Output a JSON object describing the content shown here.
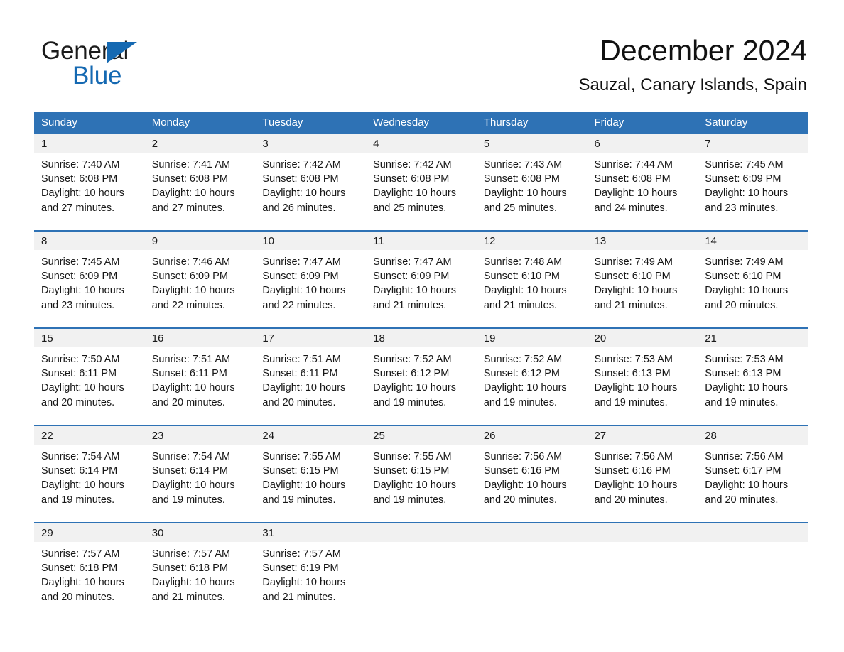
{
  "brand": {
    "name_part1": "General",
    "name_part2": "Blue",
    "triangle_color": "#1569b2"
  },
  "header": {
    "title": "December 2024",
    "subtitle": "Sauzal, Canary Islands, Spain"
  },
  "theme": {
    "header_blue": "#2e72b5",
    "row_border_blue": "#2e72b5",
    "daynum_band": "#f1f1f1",
    "text": "#161616"
  },
  "weekdays": [
    "Sunday",
    "Monday",
    "Tuesday",
    "Wednesday",
    "Thursday",
    "Friday",
    "Saturday"
  ],
  "weeks": [
    [
      {
        "day": "1",
        "sunrise": "Sunrise: 7:40 AM",
        "sunset": "Sunset: 6:08 PM",
        "daylight_line1": "Daylight: 10 hours",
        "daylight_line2": "and 27 minutes."
      },
      {
        "day": "2",
        "sunrise": "Sunrise: 7:41 AM",
        "sunset": "Sunset: 6:08 PM",
        "daylight_line1": "Daylight: 10 hours",
        "daylight_line2": "and 27 minutes."
      },
      {
        "day": "3",
        "sunrise": "Sunrise: 7:42 AM",
        "sunset": "Sunset: 6:08 PM",
        "daylight_line1": "Daylight: 10 hours",
        "daylight_line2": "and 26 minutes."
      },
      {
        "day": "4",
        "sunrise": "Sunrise: 7:42 AM",
        "sunset": "Sunset: 6:08 PM",
        "daylight_line1": "Daylight: 10 hours",
        "daylight_line2": "and 25 minutes."
      },
      {
        "day": "5",
        "sunrise": "Sunrise: 7:43 AM",
        "sunset": "Sunset: 6:08 PM",
        "daylight_line1": "Daylight: 10 hours",
        "daylight_line2": "and 25 minutes."
      },
      {
        "day": "6",
        "sunrise": "Sunrise: 7:44 AM",
        "sunset": "Sunset: 6:08 PM",
        "daylight_line1": "Daylight: 10 hours",
        "daylight_line2": "and 24 minutes."
      },
      {
        "day": "7",
        "sunrise": "Sunrise: 7:45 AM",
        "sunset": "Sunset: 6:09 PM",
        "daylight_line1": "Daylight: 10 hours",
        "daylight_line2": "and 23 minutes."
      }
    ],
    [
      {
        "day": "8",
        "sunrise": "Sunrise: 7:45 AM",
        "sunset": "Sunset: 6:09 PM",
        "daylight_line1": "Daylight: 10 hours",
        "daylight_line2": "and 23 minutes."
      },
      {
        "day": "9",
        "sunrise": "Sunrise: 7:46 AM",
        "sunset": "Sunset: 6:09 PM",
        "daylight_line1": "Daylight: 10 hours",
        "daylight_line2": "and 22 minutes."
      },
      {
        "day": "10",
        "sunrise": "Sunrise: 7:47 AM",
        "sunset": "Sunset: 6:09 PM",
        "daylight_line1": "Daylight: 10 hours",
        "daylight_line2": "and 22 minutes."
      },
      {
        "day": "11",
        "sunrise": "Sunrise: 7:47 AM",
        "sunset": "Sunset: 6:09 PM",
        "daylight_line1": "Daylight: 10 hours",
        "daylight_line2": "and 21 minutes."
      },
      {
        "day": "12",
        "sunrise": "Sunrise: 7:48 AM",
        "sunset": "Sunset: 6:10 PM",
        "daylight_line1": "Daylight: 10 hours",
        "daylight_line2": "and 21 minutes."
      },
      {
        "day": "13",
        "sunrise": "Sunrise: 7:49 AM",
        "sunset": "Sunset: 6:10 PM",
        "daylight_line1": "Daylight: 10 hours",
        "daylight_line2": "and 21 minutes."
      },
      {
        "day": "14",
        "sunrise": "Sunrise: 7:49 AM",
        "sunset": "Sunset: 6:10 PM",
        "daylight_line1": "Daylight: 10 hours",
        "daylight_line2": "and 20 minutes."
      }
    ],
    [
      {
        "day": "15",
        "sunrise": "Sunrise: 7:50 AM",
        "sunset": "Sunset: 6:11 PM",
        "daylight_line1": "Daylight: 10 hours",
        "daylight_line2": "and 20 minutes."
      },
      {
        "day": "16",
        "sunrise": "Sunrise: 7:51 AM",
        "sunset": "Sunset: 6:11 PM",
        "daylight_line1": "Daylight: 10 hours",
        "daylight_line2": "and 20 minutes."
      },
      {
        "day": "17",
        "sunrise": "Sunrise: 7:51 AM",
        "sunset": "Sunset: 6:11 PM",
        "daylight_line1": "Daylight: 10 hours",
        "daylight_line2": "and 20 minutes."
      },
      {
        "day": "18",
        "sunrise": "Sunrise: 7:52 AM",
        "sunset": "Sunset: 6:12 PM",
        "daylight_line1": "Daylight: 10 hours",
        "daylight_line2": "and 19 minutes."
      },
      {
        "day": "19",
        "sunrise": "Sunrise: 7:52 AM",
        "sunset": "Sunset: 6:12 PM",
        "daylight_line1": "Daylight: 10 hours",
        "daylight_line2": "and 19 minutes."
      },
      {
        "day": "20",
        "sunrise": "Sunrise: 7:53 AM",
        "sunset": "Sunset: 6:13 PM",
        "daylight_line1": "Daylight: 10 hours",
        "daylight_line2": "and 19 minutes."
      },
      {
        "day": "21",
        "sunrise": "Sunrise: 7:53 AM",
        "sunset": "Sunset: 6:13 PM",
        "daylight_line1": "Daylight: 10 hours",
        "daylight_line2": "and 19 minutes."
      }
    ],
    [
      {
        "day": "22",
        "sunrise": "Sunrise: 7:54 AM",
        "sunset": "Sunset: 6:14 PM",
        "daylight_line1": "Daylight: 10 hours",
        "daylight_line2": "and 19 minutes."
      },
      {
        "day": "23",
        "sunrise": "Sunrise: 7:54 AM",
        "sunset": "Sunset: 6:14 PM",
        "daylight_line1": "Daylight: 10 hours",
        "daylight_line2": "and 19 minutes."
      },
      {
        "day": "24",
        "sunrise": "Sunrise: 7:55 AM",
        "sunset": "Sunset: 6:15 PM",
        "daylight_line1": "Daylight: 10 hours",
        "daylight_line2": "and 19 minutes."
      },
      {
        "day": "25",
        "sunrise": "Sunrise: 7:55 AM",
        "sunset": "Sunset: 6:15 PM",
        "daylight_line1": "Daylight: 10 hours",
        "daylight_line2": "and 19 minutes."
      },
      {
        "day": "26",
        "sunrise": "Sunrise: 7:56 AM",
        "sunset": "Sunset: 6:16 PM",
        "daylight_line1": "Daylight: 10 hours",
        "daylight_line2": "and 20 minutes."
      },
      {
        "day": "27",
        "sunrise": "Sunrise: 7:56 AM",
        "sunset": "Sunset: 6:16 PM",
        "daylight_line1": "Daylight: 10 hours",
        "daylight_line2": "and 20 minutes."
      },
      {
        "day": "28",
        "sunrise": "Sunrise: 7:56 AM",
        "sunset": "Sunset: 6:17 PM",
        "daylight_line1": "Daylight: 10 hours",
        "daylight_line2": "and 20 minutes."
      }
    ],
    [
      {
        "day": "29",
        "sunrise": "Sunrise: 7:57 AM",
        "sunset": "Sunset: 6:18 PM",
        "daylight_line1": "Daylight: 10 hours",
        "daylight_line2": "and 20 minutes."
      },
      {
        "day": "30",
        "sunrise": "Sunrise: 7:57 AM",
        "sunset": "Sunset: 6:18 PM",
        "daylight_line1": "Daylight: 10 hours",
        "daylight_line2": "and 21 minutes."
      },
      {
        "day": "31",
        "sunrise": "Sunrise: 7:57 AM",
        "sunset": "Sunset: 6:19 PM",
        "daylight_line1": "Daylight: 10 hours",
        "daylight_line2": "and 21 minutes."
      },
      {
        "day": "",
        "sunrise": "",
        "sunset": "",
        "daylight_line1": "",
        "daylight_line2": ""
      },
      {
        "day": "",
        "sunrise": "",
        "sunset": "",
        "daylight_line1": "",
        "daylight_line2": ""
      },
      {
        "day": "",
        "sunrise": "",
        "sunset": "",
        "daylight_line1": "",
        "daylight_line2": ""
      },
      {
        "day": "",
        "sunrise": "",
        "sunset": "",
        "daylight_line1": "",
        "daylight_line2": ""
      }
    ]
  ]
}
